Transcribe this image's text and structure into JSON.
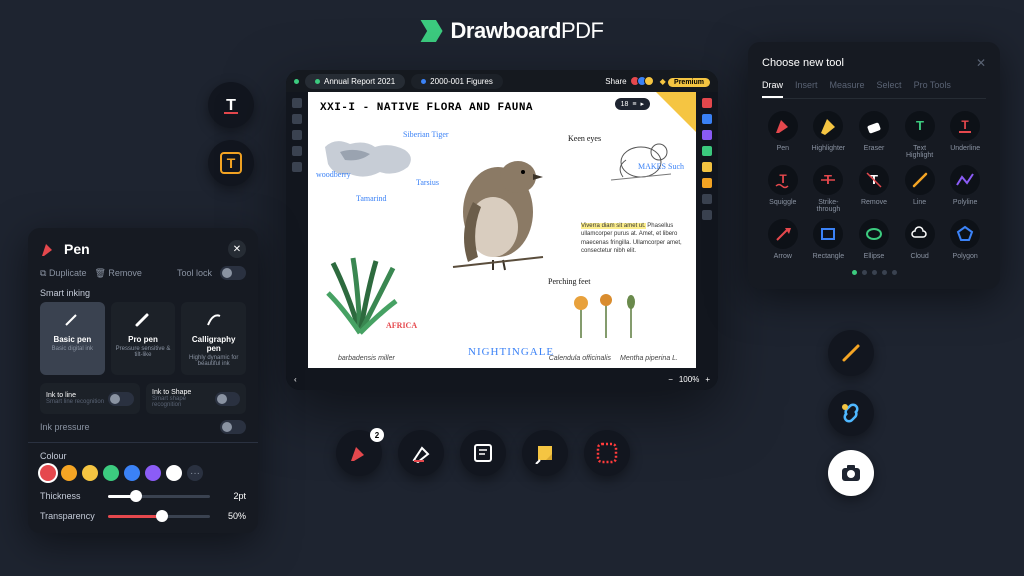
{
  "brand": {
    "name_bold": "Drawboard",
    "name_thin": "PDF"
  },
  "tablet": {
    "tabs": [
      {
        "label": "Annual Report 2021",
        "active": true,
        "dot": "#3ccb7f"
      },
      {
        "label": "2000-001 Figures",
        "active": false,
        "dot": "#3b82f6"
      }
    ],
    "share": "Share",
    "premium": "Premium",
    "page_current": "18",
    "page_button": "▸",
    "zoom": "100%",
    "doc_title": "XXI-I - NATIVE FLORA AND FAUNA",
    "annotations": {
      "siberian": "Siberian Tiger",
      "woodberry": "woodberry",
      "tamarind": "Tamarind",
      "tarsius": "Tarsius",
      "keeneyes": "Keen eyes",
      "makes": "MAKES Such",
      "perching": "Perching feet",
      "africa": "AFRICA",
      "nightingale": "NIGHTINGALE"
    },
    "latin_highlight": "Viverra diam sit amet ut.",
    "latin_body": "Phasellus ullamcorper purus at. Amet, et libero maecenas fringilla. Ullamcorper amet, consectetur nibh elit.",
    "captions": {
      "c1": "barbadensis miller",
      "c2": "Calendula officinalis",
      "c3": "Mentha piperina L."
    }
  },
  "pen_panel": {
    "title": "Pen",
    "duplicate": "Duplicate",
    "remove": "Remove",
    "tool_lock": "Tool lock",
    "smart_inking": "Smart inking",
    "types": [
      {
        "name": "Basic pen",
        "desc": "Basic digital ink",
        "selected": true
      },
      {
        "name": "Pro pen",
        "desc": "Pressure sensitive & tilt-like",
        "selected": false
      },
      {
        "name": "Calligraphy pen",
        "desc": "Highly dynamic for beautiful ink",
        "selected": false
      }
    ],
    "ink_line": "Ink to line",
    "ink_line_sub": "Smart line recognition",
    "ink_shape": "Ink to Shape",
    "ink_shape_sub": "Smart shape recognition",
    "ink_pressure": "Ink pressure",
    "colour_label": "Colour",
    "colours": [
      "#e5484d",
      "#f5a524",
      "#f5c542",
      "#3ccb7f",
      "#3b82f6",
      "#8b5cf6",
      "#ffffff"
    ],
    "thickness_label": "Thickness",
    "thickness_value": "2pt",
    "transparency_label": "Transparency",
    "transparency_value": "50%"
  },
  "tool_panel": {
    "title": "Choose new tool",
    "tabs": [
      "Draw",
      "Insert",
      "Measure",
      "Select",
      "Pro Tools"
    ],
    "active_tab": "Draw",
    "tools": [
      {
        "name": "Pen",
        "color": "#e5484d"
      },
      {
        "name": "Highlighter",
        "color": "#f5c542"
      },
      {
        "name": "Eraser",
        "color": "#ffffff"
      },
      {
        "name": "Text Highlight",
        "color": "#3ccb7f"
      },
      {
        "name": "Underline",
        "color": "#e5484d"
      },
      {
        "name": "Squiggle",
        "color": "#e5484d"
      },
      {
        "name": "Strike-through",
        "color": "#e5484d"
      },
      {
        "name": "Remove",
        "color": "#ffffff"
      },
      {
        "name": "Line",
        "color": "#f5a524"
      },
      {
        "name": "Polyline",
        "color": "#8b5cf6"
      },
      {
        "name": "Arrow",
        "color": "#e5484d"
      },
      {
        "name": "Rectangle",
        "color": "#3b82f6"
      },
      {
        "name": "Ellipse",
        "color": "#3ccb7f"
      },
      {
        "name": "Cloud",
        "color": "#ffffff"
      },
      {
        "name": "Polygon",
        "color": "#3b82f6"
      }
    ]
  },
  "bottom_circles": {
    "pen_badge": "2"
  }
}
